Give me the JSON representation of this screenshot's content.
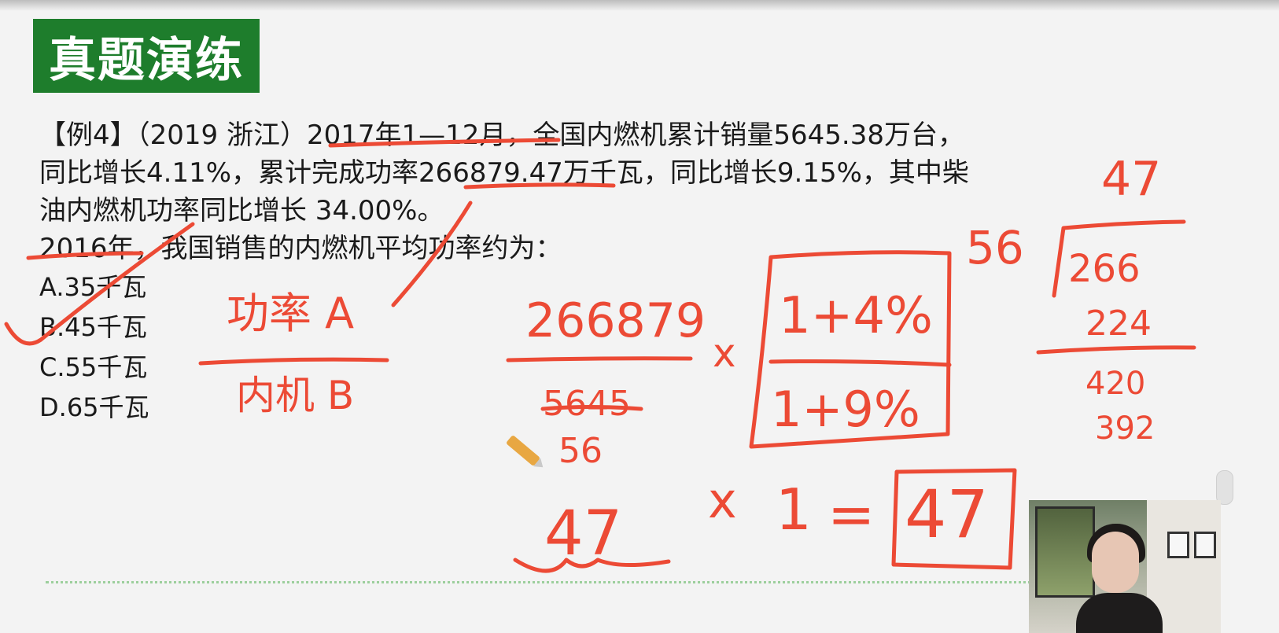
{
  "title": "真题演练",
  "question": {
    "line1": "【例4】（2019 浙江）2017年1—12月，全国内燃机累计销量5645.38万台，",
    "line2": "同比增长4.11%，累计完成功率266879.47万千瓦，同比增长9.15%，其中柴",
    "line3": "油内燃机功率同比增长 34.00%。",
    "line4": "2016年，我国销售的内燃机平均功率约为："
  },
  "options": [
    "A.35千瓦",
    "B.45千瓦",
    "C.55千瓦",
    "D.65千瓦"
  ],
  "annotations": {
    "note_a": "功率 A",
    "note_b": "内机 B",
    "numerator": "266879",
    "denominator_struck": "5645",
    "denominator": "56",
    "times1": "x",
    "growth_num": "1+4%",
    "growth_den": "1+9%",
    "side_56": "56",
    "result_approx": "47",
    "times2": "x",
    "one": "1",
    "equals": "=",
    "boxed_result": "47",
    "div_quotient": "47",
    "div_dividend": "266",
    "div_sub1": "224",
    "div_rem": "420",
    "div_sub2": "392"
  },
  "colors": {
    "title_bg": "#1e7d2c",
    "ink": "#ec4a35",
    "text": "#1a1a1a"
  },
  "icons": [
    "pencil-cursor-icon",
    "webcam-feed"
  ]
}
